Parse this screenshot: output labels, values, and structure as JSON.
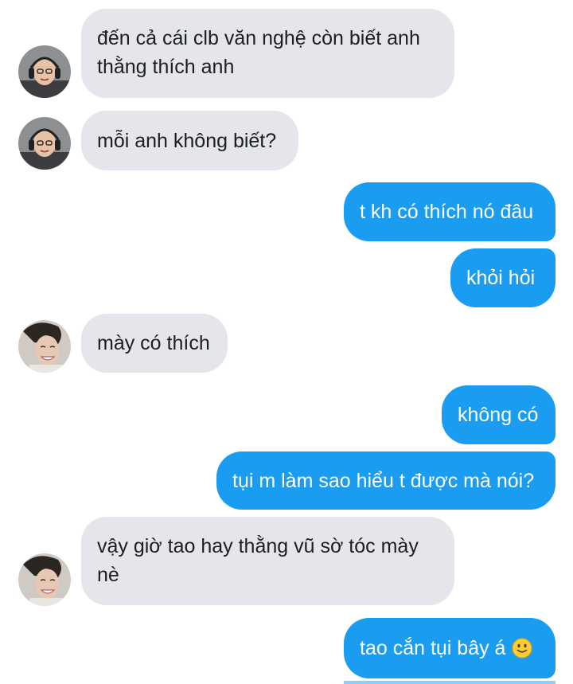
{
  "conversation": {
    "messages": [
      {
        "sender": "them",
        "avatar": "avatar-headset-icon",
        "text": "đến cả cái clb văn nghệ còn biết anh\nthằng thích anh"
      },
      {
        "sender": "them",
        "avatar": "avatar-headset-icon",
        "text": "mỗi anh không biết?"
      },
      {
        "sender": "me",
        "text": "t kh có thích nó đâu"
      },
      {
        "sender": "me",
        "text": "khỏi hỏi"
      },
      {
        "sender": "them",
        "avatar": "avatar-smiling-man-icon",
        "text": "mày có thích"
      },
      {
        "sender": "me",
        "text": "không có"
      },
      {
        "sender": "me",
        "text": "tụi m làm sao hiểu t được mà nói?"
      },
      {
        "sender": "them",
        "avatar": "avatar-smiling-man-icon",
        "text": "vậy giờ tao hay thằng vũ sờ tóc mày\nnè"
      },
      {
        "sender": "me",
        "text": "tao cắn tụi bây á",
        "emoji": "slightly-smiling-face-icon"
      }
    ]
  },
  "colors": {
    "incoming_bubble": "#e4e6eb",
    "outgoing_bubble": "#1a9df0",
    "incoming_text": "#1c1e21",
    "outgoing_text": "#ffffff"
  }
}
